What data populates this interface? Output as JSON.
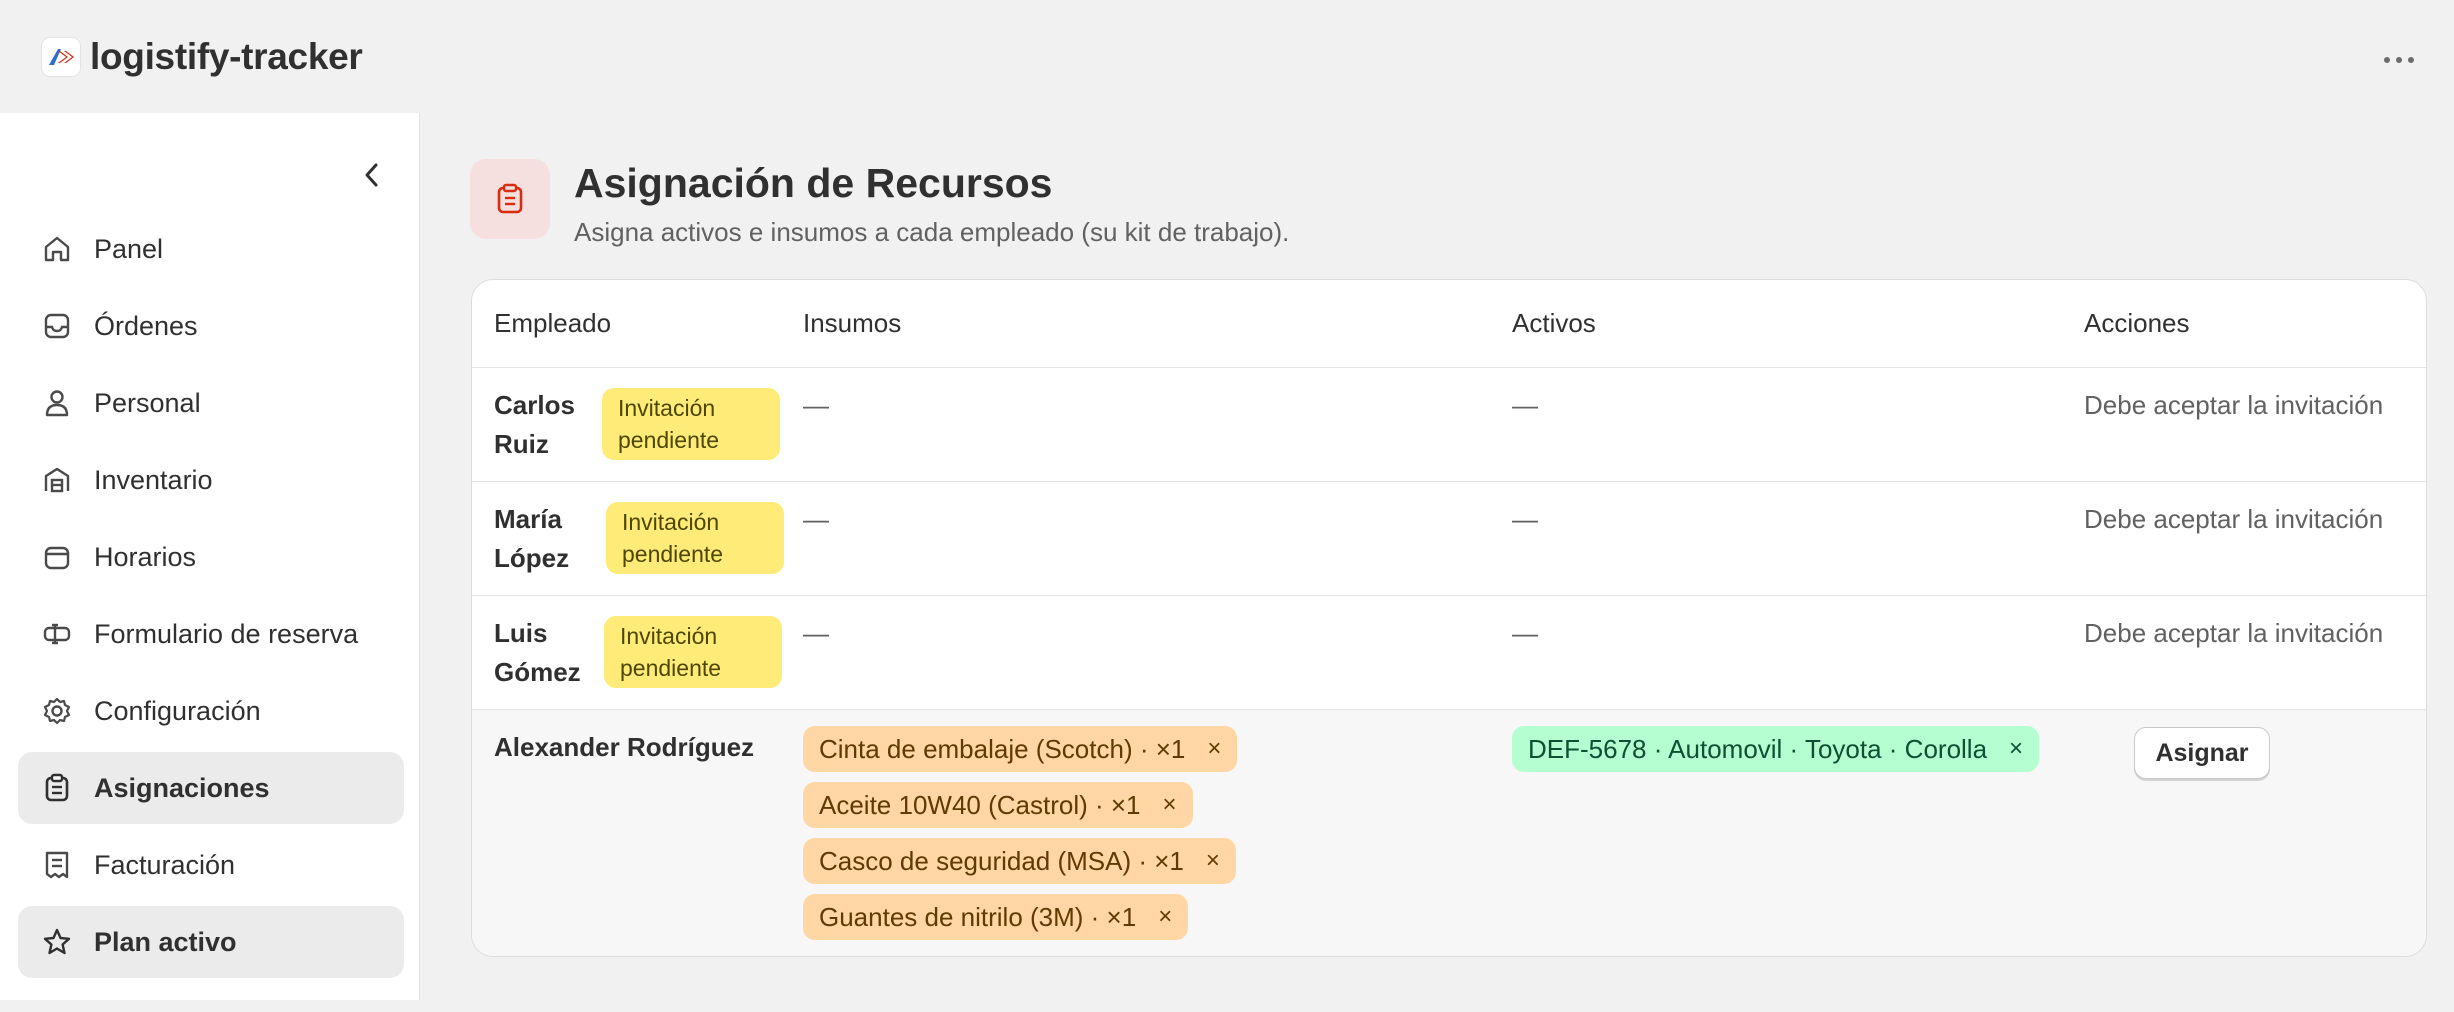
{
  "app": {
    "title": "logistify-tracker",
    "logo_icon": "logistify-logo"
  },
  "sidebar": {
    "items": [
      {
        "label": "Panel",
        "icon": "home-icon",
        "active": false
      },
      {
        "label": "Órdenes",
        "icon": "inbox-icon",
        "active": false
      },
      {
        "label": "Personal",
        "icon": "person-icon",
        "active": false
      },
      {
        "label": "Inventario",
        "icon": "warehouse-icon",
        "active": false
      },
      {
        "label": "Horarios",
        "icon": "calendar-icon",
        "active": false
      },
      {
        "label": "Formulario de reserva",
        "icon": "form-icon",
        "active": false
      },
      {
        "label": "Configuración",
        "icon": "gear-icon",
        "active": false
      },
      {
        "label": "Asignaciones",
        "icon": "clipboard-icon",
        "active": true
      },
      {
        "label": "Facturación",
        "icon": "receipt-icon",
        "active": false
      },
      {
        "label": "Plan activo",
        "icon": "star-icon",
        "active": true
      }
    ]
  },
  "header": {
    "title": "Asignación de Recursos",
    "subtitle": "Asigna activos e insumos a cada empleado (su kit de trabajo)."
  },
  "table": {
    "columns": [
      "Empleado",
      "Insumos",
      "Activos",
      "Acciones"
    ],
    "rows": [
      {
        "name_line1": "Carlos",
        "name_line2": "Ruiz",
        "badge_line1": "Invitación",
        "badge_line2": "pendiente",
        "insumos": "—",
        "activos": "—",
        "action": "Debe aceptar la invitación"
      },
      {
        "name_line1": "María",
        "name_line2": "López",
        "badge_line1": "Invitación",
        "badge_line2": "pendiente",
        "insumos": "—",
        "activos": "—",
        "action": "Debe aceptar la invitación"
      },
      {
        "name_line1": "Luis",
        "name_line2": "Gómez",
        "badge_line1": "Invitación",
        "badge_line2": "pendiente",
        "insumos": "—",
        "activos": "—",
        "action": "Debe aceptar la invitación"
      }
    ],
    "active_row": {
      "name": "Alexander Rodríguez",
      "insumos": [
        "Cinta de embalaje (Scotch) · ×1",
        "Aceite 10W40 (Castrol) · ×1",
        "Casco de seguridad (MSA) · ×1",
        "Guantes de nitrilo (3M) · ×1"
      ],
      "activos": [
        "DEF-5678 · Automovil · Toyota · Corolla"
      ],
      "remove_symbol": "×",
      "assign_label": "Asignar"
    }
  },
  "colors": {
    "badge_pending": "#ffeb78",
    "chip_insumo": "#ffd6a4",
    "chip_activo": "#b4fed2",
    "header_icon_bg": "#f6dfdf",
    "accent_red": "#d72c0d"
  }
}
